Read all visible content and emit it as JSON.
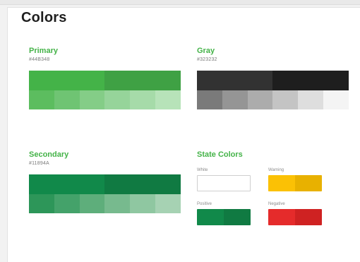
{
  "page": {
    "title": "Colors"
  },
  "primary": {
    "name": "Primary",
    "hex": "#44B348",
    "name_color": "#44B348",
    "main": [
      "#44B348",
      "#44B348",
      "#44B348",
      "#3fa144",
      "#3fa144",
      "#3fa144"
    ],
    "tints": [
      "#5cbd5f",
      "#6fc473",
      "#84cd87",
      "#96d49a",
      "#a6dba9",
      "#b7e3b9"
    ]
  },
  "gray": {
    "name": "Gray",
    "hex": "#323232",
    "name_color": "#44B348",
    "main": [
      "#323232",
      "#323232",
      "#323232",
      "#1e1e1e",
      "#1e1e1e",
      "#1e1e1e"
    ],
    "tints": [
      "#7a7a7a",
      "#959595",
      "#acacac",
      "#c4c4c4",
      "#dedede",
      "#f4f4f4"
    ]
  },
  "secondary": {
    "name": "Secondary",
    "hex": "#11894A",
    "name_color": "#44B348",
    "main": [
      "#11894A",
      "#11894A",
      "#11894A",
      "#107a42",
      "#107a42",
      "#107a42"
    ],
    "tints": [
      "#2d9659",
      "#44a26a",
      "#5eae7b",
      "#77ba8e",
      "#8fc7a1",
      "#a6d2b3"
    ]
  },
  "state": {
    "title": "State Colors",
    "white": {
      "label": "White",
      "colors": [
        "#ffffff"
      ]
    },
    "warning": {
      "label": "Warning",
      "colors": [
        "#fbc105",
        "#e8b100"
      ]
    },
    "positive": {
      "label": "Positive",
      "colors": [
        "#11894A",
        "#107a42"
      ]
    },
    "negative": {
      "label": "Negative",
      "colors": [
        "#e52b2b",
        "#cf2222"
      ]
    }
  }
}
